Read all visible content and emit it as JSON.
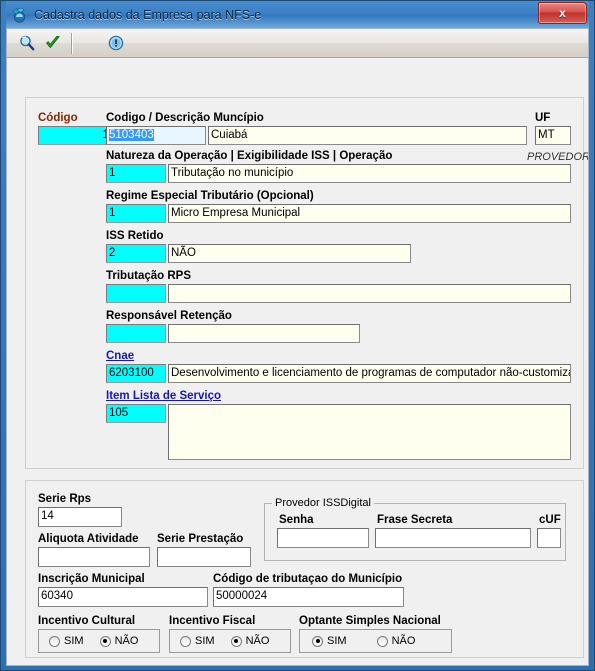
{
  "window": {
    "title": "Cadastra dados da Empresa para NFS-e",
    "app_icon": "company-register-icon",
    "close_label": "x"
  },
  "toolbar": {
    "items": [
      {
        "name": "search-icon",
        "label": ""
      },
      {
        "name": "confirm-check-icon",
        "label": ""
      },
      {
        "name": "info-icon",
        "label": ""
      }
    ]
  },
  "form": {
    "codigo": {
      "label": "Código",
      "value": "1"
    },
    "municipio": {
      "label": "Codigo / Descrição Muncípio",
      "code": "5103403",
      "description": "Cuiabá"
    },
    "uf": {
      "label": "UF",
      "value": "MT"
    },
    "natureza": {
      "label": "Natureza da Operação | Exigibilidade ISS | Operação",
      "tag": "PROVEDOR",
      "code": "1",
      "description": "Tributação no município"
    },
    "regime": {
      "label": "Regime Especial Tributário (Opcional)",
      "code": "1",
      "description": "Micro Empresa Municipal"
    },
    "iss_retido": {
      "label": "ISS Retido",
      "code": "2",
      "description": "NÃO"
    },
    "tributacao_rps": {
      "label": "Tributação RPS",
      "code": "",
      "description": ""
    },
    "responsavel_retencao": {
      "label": "Responsável Retenção",
      "code": "",
      "description": ""
    },
    "cnae": {
      "label": "Cnae",
      "code": "6203100",
      "description": "Desenvolvimento e licenciamento de programas de computador não-customizáveis"
    },
    "item_lista": {
      "label": "Item Lista de Serviço",
      "code": "105",
      "description": ""
    }
  },
  "bottom": {
    "serie_rps": {
      "label": "Serie Rps",
      "value": "14"
    },
    "aliquota_atividade": {
      "label": "Aliquota Atividade",
      "value": ""
    },
    "serie_prestacao": {
      "label": "Serie Prestação",
      "value": ""
    },
    "provedor": {
      "title": "Provedor ISSDigital",
      "senha": {
        "label": "Senha",
        "value": ""
      },
      "frase_secreta": {
        "label": "Frase Secreta",
        "value": ""
      },
      "cuf": {
        "label": "cUF",
        "value": ""
      }
    },
    "inscricao_municipal": {
      "label": "Inscrição Municipal",
      "value": "60340"
    },
    "codigo_tributacao": {
      "label": "Código de tributaçao do Município",
      "value": "50000024"
    },
    "incentivo_cultural": {
      "label": "Incentivo Cultural",
      "options": [
        "SIM",
        "NÃO"
      ],
      "selected": "NÃO"
    },
    "incentivo_fiscal": {
      "label": "Incentivo Fiscal",
      "options": [
        "SIM",
        "NÃO"
      ],
      "selected": "NÃO"
    },
    "optante_simples": {
      "label": "Optante Simples Nacional",
      "options": [
        "SIM",
        "NÃO"
      ],
      "selected": "SIM"
    }
  },
  "colors": {
    "title_bar": "#3b7ec4",
    "close_button": "#c3302c",
    "field_cyan": "#00ffff",
    "field_cream": "#fffff0",
    "label_red": "#8b2500",
    "link_blue": "#1414c8",
    "selection_blue": "#3399ff"
  }
}
